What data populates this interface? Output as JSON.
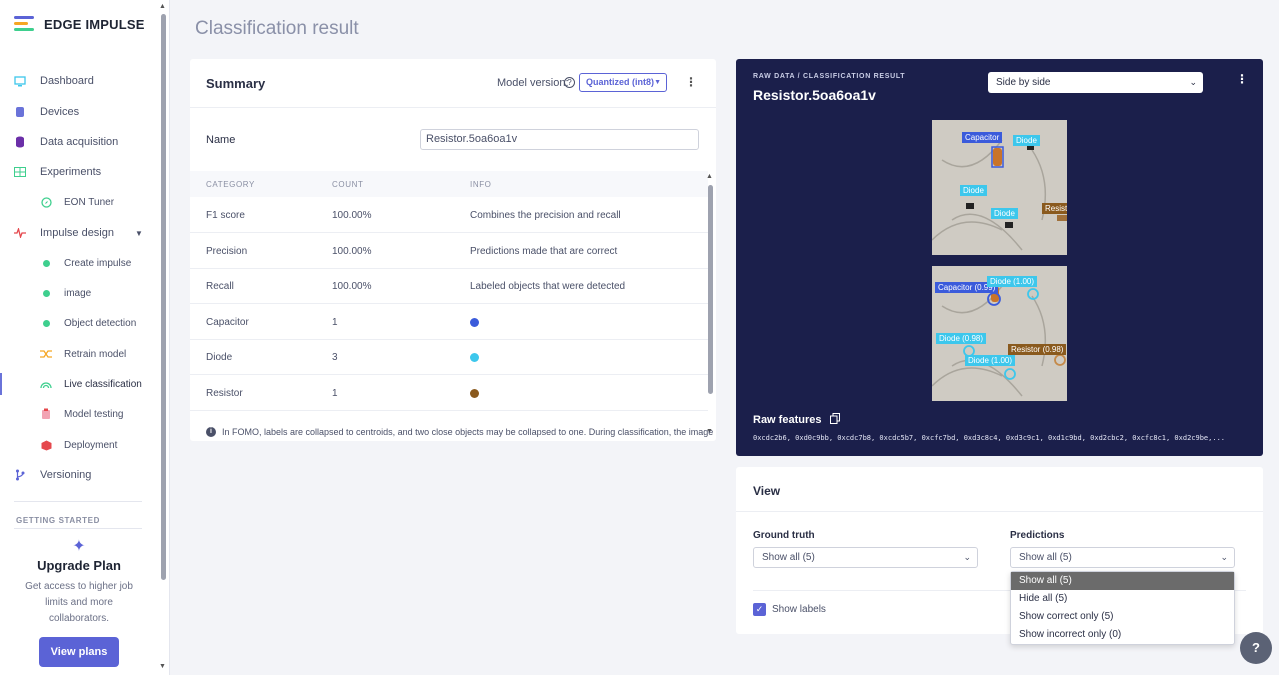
{
  "brand": {
    "name": "EDGE IMPULSE"
  },
  "sidebar": {
    "items": [
      {
        "label": "Dashboard",
        "icon": "monitor-icon"
      },
      {
        "label": "Devices",
        "icon": "device-icon"
      },
      {
        "label": "Data acquisition",
        "icon": "database-icon"
      },
      {
        "label": "Experiments",
        "icon": "table-icon"
      },
      {
        "label": "EON Tuner",
        "icon": "compass-icon"
      },
      {
        "label": "Impulse design",
        "icon": "pulse-icon"
      },
      {
        "label": "Create impulse",
        "icon": "green-dot-icon"
      },
      {
        "label": "image",
        "icon": "green-dot-icon"
      },
      {
        "label": "Object detection",
        "icon": "green-dot-icon"
      },
      {
        "label": "Retrain model",
        "icon": "shuffle-icon"
      },
      {
        "label": "Live classification",
        "icon": "signal-icon"
      },
      {
        "label": "Model testing",
        "icon": "clipboard-icon"
      },
      {
        "label": "Deployment",
        "icon": "cube-icon"
      },
      {
        "label": "Versioning",
        "icon": "branch-icon"
      }
    ],
    "getting_started": "GETTING STARTED",
    "upgrade": {
      "title": "Upgrade Plan",
      "desc": "Get access to higher job limits and more collaborators.",
      "button": "View plans"
    }
  },
  "page": {
    "title": "Classification result"
  },
  "summary": {
    "title": "Summary",
    "model_version_label": "Model version:",
    "model_version": "Quantized (int8)",
    "name_label": "Name",
    "name_value": "Resistor.5oa6oa1v",
    "headers": [
      "CATEGORY",
      "COUNT",
      "INFO"
    ],
    "rows": [
      {
        "category": "F1 score",
        "count": "100.00%",
        "info": "Combines the precision and recall"
      },
      {
        "category": "Precision",
        "count": "100.00%",
        "info": "Predictions made that are correct"
      },
      {
        "category": "Recall",
        "count": "100.00%",
        "info": "Labeled objects that were detected"
      },
      {
        "category": "Capacitor",
        "count": "1",
        "color": "#3b5bdb"
      },
      {
        "category": "Diode",
        "count": "3",
        "color": "#3dc7ec"
      },
      {
        "category": "Resistor",
        "count": "1",
        "color": "#8a5a1e"
      }
    ],
    "footnote": "In FOMO, labels are collapsed to centroids, and two close objects may be collapsed to one. During classification, the image"
  },
  "raw": {
    "subtitle": "RAW DATA / CLASSIFICATION RESULT",
    "title": "Resistor.5oa6oa1v",
    "view_mode": "Side by side",
    "ground_truth_labels": {
      "capacitor": "Capacitor",
      "diode_1": "Diode",
      "diode_2": "Diode",
      "diode_3": "Diode",
      "resistor": "Resistor"
    },
    "prediction_labels": {
      "capacitor": "Capacitor (0.99)",
      "diode_1": "Diode (1.00)",
      "diode_2": "Diode (0.98)",
      "diode_3": "Diode (1.00)",
      "resistor": "Resistor (0.98)"
    },
    "features_label": "Raw features",
    "features_value": "0xcdc2b6, 0xd0c9bb, 0xcdc7b8, 0xcdc5b7, 0xcfc7bd, 0xd3c8c4, 0xd3c9c1, 0xd1c9bd, 0xd2cbc2, 0xcfc8c1, 0xd2c9be,..."
  },
  "view": {
    "title": "View",
    "ground_truth_label": "Ground truth",
    "ground_truth_value": "Show all (5)",
    "predictions_label": "Predictions",
    "predictions_value": "Show all (5)",
    "show_labels": "Show labels",
    "options": [
      "Show all (5)",
      "Hide all (5)",
      "Show correct only (5)",
      "Show incorrect only (0)"
    ]
  },
  "colors": {
    "accent": "#5b63d6",
    "capacitor": "#3b5bdb",
    "diode": "#3dc7ec",
    "resistor": "#8a5a1e",
    "panel_bg": "#1b1f4b"
  }
}
